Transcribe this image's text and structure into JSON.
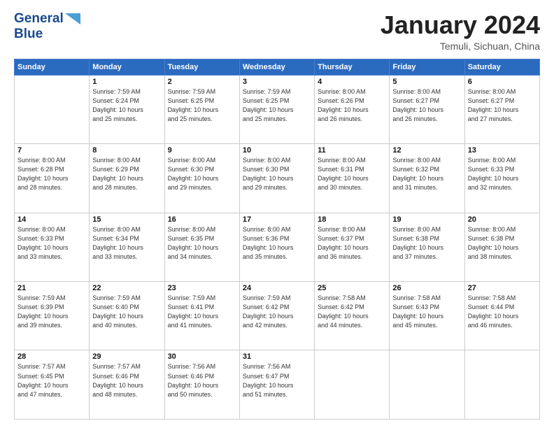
{
  "header": {
    "logo_line1": "General",
    "logo_line2": "Blue",
    "month": "January 2024",
    "location": "Temuli, Sichuan, China"
  },
  "weekdays": [
    "Sunday",
    "Monday",
    "Tuesday",
    "Wednesday",
    "Thursday",
    "Friday",
    "Saturday"
  ],
  "weeks": [
    [
      {
        "day": "",
        "info": ""
      },
      {
        "day": "1",
        "info": "Sunrise: 7:59 AM\nSunset: 6:24 PM\nDaylight: 10 hours\nand 25 minutes."
      },
      {
        "day": "2",
        "info": "Sunrise: 7:59 AM\nSunset: 6:25 PM\nDaylight: 10 hours\nand 25 minutes."
      },
      {
        "day": "3",
        "info": "Sunrise: 7:59 AM\nSunset: 6:25 PM\nDaylight: 10 hours\nand 25 minutes."
      },
      {
        "day": "4",
        "info": "Sunrise: 8:00 AM\nSunset: 6:26 PM\nDaylight: 10 hours\nand 26 minutes."
      },
      {
        "day": "5",
        "info": "Sunrise: 8:00 AM\nSunset: 6:27 PM\nDaylight: 10 hours\nand 26 minutes."
      },
      {
        "day": "6",
        "info": "Sunrise: 8:00 AM\nSunset: 6:27 PM\nDaylight: 10 hours\nand 27 minutes."
      }
    ],
    [
      {
        "day": "7",
        "info": "Sunrise: 8:00 AM\nSunset: 6:28 PM\nDaylight: 10 hours\nand 28 minutes."
      },
      {
        "day": "8",
        "info": "Sunrise: 8:00 AM\nSunset: 6:29 PM\nDaylight: 10 hours\nand 28 minutes."
      },
      {
        "day": "9",
        "info": "Sunrise: 8:00 AM\nSunset: 6:30 PM\nDaylight: 10 hours\nand 29 minutes."
      },
      {
        "day": "10",
        "info": "Sunrise: 8:00 AM\nSunset: 6:30 PM\nDaylight: 10 hours\nand 29 minutes."
      },
      {
        "day": "11",
        "info": "Sunrise: 8:00 AM\nSunset: 6:31 PM\nDaylight: 10 hours\nand 30 minutes."
      },
      {
        "day": "12",
        "info": "Sunrise: 8:00 AM\nSunset: 6:32 PM\nDaylight: 10 hours\nand 31 minutes."
      },
      {
        "day": "13",
        "info": "Sunrise: 8:00 AM\nSunset: 6:33 PM\nDaylight: 10 hours\nand 32 minutes."
      }
    ],
    [
      {
        "day": "14",
        "info": "Sunrise: 8:00 AM\nSunset: 6:33 PM\nDaylight: 10 hours\nand 33 minutes."
      },
      {
        "day": "15",
        "info": "Sunrise: 8:00 AM\nSunset: 6:34 PM\nDaylight: 10 hours\nand 33 minutes."
      },
      {
        "day": "16",
        "info": "Sunrise: 8:00 AM\nSunset: 6:35 PM\nDaylight: 10 hours\nand 34 minutes."
      },
      {
        "day": "17",
        "info": "Sunrise: 8:00 AM\nSunset: 6:36 PM\nDaylight: 10 hours\nand 35 minutes."
      },
      {
        "day": "18",
        "info": "Sunrise: 8:00 AM\nSunset: 6:37 PM\nDaylight: 10 hours\nand 36 minutes."
      },
      {
        "day": "19",
        "info": "Sunrise: 8:00 AM\nSunset: 6:38 PM\nDaylight: 10 hours\nand 37 minutes."
      },
      {
        "day": "20",
        "info": "Sunrise: 8:00 AM\nSunset: 6:38 PM\nDaylight: 10 hours\nand 38 minutes."
      }
    ],
    [
      {
        "day": "21",
        "info": "Sunrise: 7:59 AM\nSunset: 6:39 PM\nDaylight: 10 hours\nand 39 minutes."
      },
      {
        "day": "22",
        "info": "Sunrise: 7:59 AM\nSunset: 6:40 PM\nDaylight: 10 hours\nand 40 minutes."
      },
      {
        "day": "23",
        "info": "Sunrise: 7:59 AM\nSunset: 6:41 PM\nDaylight: 10 hours\nand 41 minutes."
      },
      {
        "day": "24",
        "info": "Sunrise: 7:59 AM\nSunset: 6:42 PM\nDaylight: 10 hours\nand 42 minutes."
      },
      {
        "day": "25",
        "info": "Sunrise: 7:58 AM\nSunset: 6:42 PM\nDaylight: 10 hours\nand 44 minutes."
      },
      {
        "day": "26",
        "info": "Sunrise: 7:58 AM\nSunset: 6:43 PM\nDaylight: 10 hours\nand 45 minutes."
      },
      {
        "day": "27",
        "info": "Sunrise: 7:58 AM\nSunset: 6:44 PM\nDaylight: 10 hours\nand 46 minutes."
      }
    ],
    [
      {
        "day": "28",
        "info": "Sunrise: 7:57 AM\nSunset: 6:45 PM\nDaylight: 10 hours\nand 47 minutes."
      },
      {
        "day": "29",
        "info": "Sunrise: 7:57 AM\nSunset: 6:46 PM\nDaylight: 10 hours\nand 48 minutes."
      },
      {
        "day": "30",
        "info": "Sunrise: 7:56 AM\nSunset: 6:46 PM\nDaylight: 10 hours\nand 50 minutes."
      },
      {
        "day": "31",
        "info": "Sunrise: 7:56 AM\nSunset: 6:47 PM\nDaylight: 10 hours\nand 51 minutes."
      },
      {
        "day": "",
        "info": ""
      },
      {
        "day": "",
        "info": ""
      },
      {
        "day": "",
        "info": ""
      }
    ]
  ]
}
